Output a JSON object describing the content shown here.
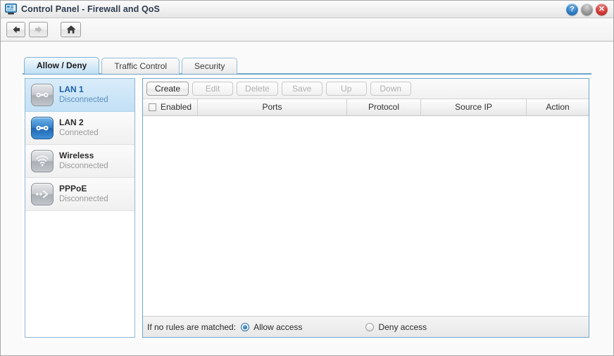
{
  "window": {
    "title": "Control Panel - Firewall and QoS",
    "app_icon": "computer-monitor-icon",
    "buttons": {
      "help": "?",
      "help_name": "help-icon",
      "minimize": "",
      "minimize_name": "minimize-icon",
      "close": "✕",
      "close_name": "close-icon"
    }
  },
  "navbar": {
    "back": "back-arrow-icon",
    "forward": "forward-arrow-icon",
    "home": "home-icon"
  },
  "tabs": [
    {
      "label": "Allow / Deny",
      "active": true
    },
    {
      "label": "Traffic Control",
      "active": false
    },
    {
      "label": "Security",
      "active": false
    }
  ],
  "sidebar": {
    "items": [
      {
        "name": "LAN 1",
        "status": "Disconnected",
        "icon": "lan-port-icon",
        "selected": true,
        "connected": false
      },
      {
        "name": "LAN 2",
        "status": "Connected",
        "icon": "lan-port-icon",
        "selected": false,
        "connected": true
      },
      {
        "name": "Wireless",
        "status": "Disconnected",
        "icon": "wifi-icon",
        "selected": false,
        "connected": false
      },
      {
        "name": "PPPoE",
        "status": "Disconnected",
        "icon": "pppoe-icon",
        "selected": false,
        "connected": false
      }
    ]
  },
  "toolbar": {
    "create": "Create",
    "edit": "Edit",
    "delete": "Delete",
    "save": "Save",
    "up": "Up",
    "down": "Down"
  },
  "table": {
    "columns": [
      "Enabled",
      "Ports",
      "Protocol",
      "Source IP",
      "Action"
    ],
    "rows": []
  },
  "footer": {
    "label": "If no rules are matched:",
    "allow": "Allow access",
    "deny": "Deny access",
    "selected": "allow"
  },
  "colors": {
    "accent_blue": "#6ea6cc",
    "tab_active_text": "#1c1c1c",
    "selected_item_text": "#1b5ea8",
    "connected_icon": "#3380c9",
    "window_border": "#a9a9a9"
  }
}
